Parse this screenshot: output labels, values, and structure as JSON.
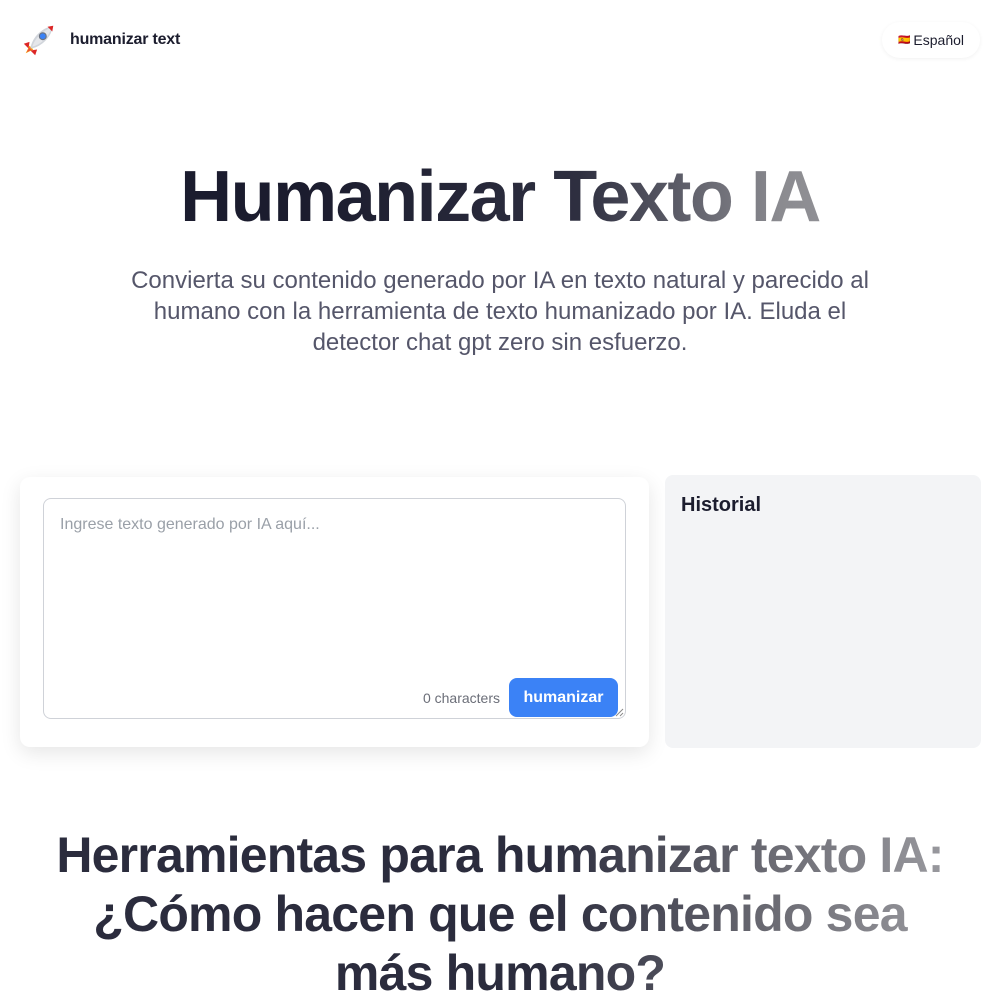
{
  "header": {
    "brand_name": "humanizar text",
    "logo_icon": "rocket-icon",
    "language_label": "Español",
    "language_flag": "🇪🇸"
  },
  "hero": {
    "title": "Humanizar Texto IA",
    "subtitle": "Convierta su contenido generado por IA en texto natural y parecido al humano con la herramienta de texto humanizado por IA. Eluda el detector chat gpt zero sin esfuerzo."
  },
  "editor": {
    "placeholder": "Ingrese texto generado por IA aquí...",
    "value": "",
    "char_count": "0 characters",
    "submit_label": "humanizar"
  },
  "history": {
    "title": "Historial"
  },
  "section": {
    "title": "Herramientas para humanizar texto IA: ¿Cómo hacen que el contenido sea más humano?"
  },
  "colors": {
    "accent": "#3b82f6",
    "panel_bg": "#f3f4f6",
    "text_dark": "#1c1d2e",
    "text_muted": "#55566a"
  }
}
